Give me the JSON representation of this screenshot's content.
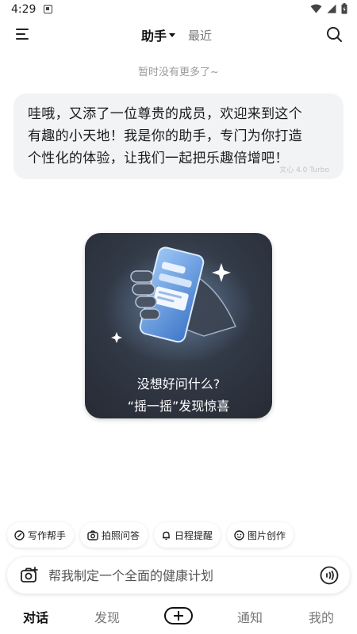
{
  "status_bar": {
    "time": "4:29",
    "app_icon": "notification-app-icon",
    "wifi_icon": "wifi-icon",
    "signal_icon": "signal-icon",
    "battery_icon": "battery-icon"
  },
  "top_nav": {
    "menu_icon": "menu-icon",
    "tab_assistant": "助手",
    "tab_recent": "最近",
    "search_icon": "search-icon"
  },
  "feed": {
    "no_more_text": "暂时没有更多了~"
  },
  "message": {
    "line1": "哇哦，又添了一位尊贵的成员，欢迎来到这个",
    "line2": "有趣的小天地！我是你的助手，专门为你打造",
    "line3": "个性化的体验，让我们一起把乐趣倍增吧！",
    "model_tag": "文心 4.0 Turbo"
  },
  "shake_card": {
    "line1": "没想好问什么?",
    "line2": "“摇一摇”发现惊喜",
    "illustration": "hand-holding-phone"
  },
  "quick_actions": [
    {
      "label": "写作帮手",
      "icon": "pen-icon"
    },
    {
      "label": "拍照问答",
      "icon": "camera-icon"
    },
    {
      "label": "日程提醒",
      "icon": "bell-icon"
    },
    {
      "label": "图片创作",
      "icon": "image-smile-icon"
    }
  ],
  "composer": {
    "placeholder": "帮我制定一个全面的健康计划",
    "camera_icon": "camera-icon",
    "voice_icon": "voice-icon"
  },
  "bottom_nav": {
    "items": [
      "对话",
      "发现",
      "通知",
      "我的"
    ],
    "active": "对话",
    "add_icon": "plus-icon"
  },
  "colors": {
    "bubble_bg": "#f2f3f5",
    "card_bg": "#2f3540",
    "accent_phone": "#6fa6ec"
  }
}
